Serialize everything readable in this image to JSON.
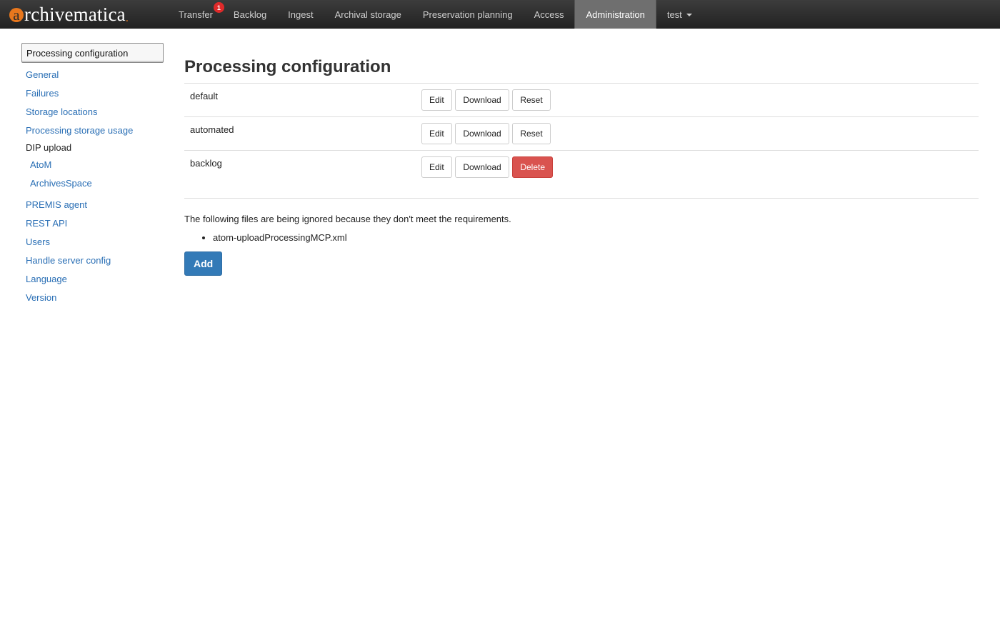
{
  "brand": {
    "name": "rchivematica",
    "initial": "a",
    "mark": "."
  },
  "nav": {
    "transfer": {
      "label": "Transfer",
      "badge": "1"
    },
    "backlog": "Backlog",
    "ingest": "Ingest",
    "archival_storage": "Archival storage",
    "preservation_planning": "Preservation planning",
    "access": "Access",
    "administration": "Administration",
    "user": "test"
  },
  "sidebar": {
    "active": "Processing configuration",
    "items": [
      "General",
      "Failures",
      "Storage locations",
      "Processing storage usage"
    ],
    "dip_upload": {
      "label": "DIP upload",
      "items": [
        "AtoM",
        "ArchivesSpace"
      ]
    },
    "items_after": [
      "PREMIS agent",
      "REST API",
      "Users",
      "Handle server config",
      "Language",
      "Version"
    ]
  },
  "main": {
    "title": "Processing configuration",
    "configs": [
      {
        "name": "default",
        "buttons": [
          "Edit",
          "Download",
          "Reset"
        ]
      },
      {
        "name": "automated",
        "buttons": [
          "Edit",
          "Download",
          "Reset"
        ]
      },
      {
        "name": "backlog",
        "buttons": [
          "Edit",
          "Download",
          "Delete"
        ]
      }
    ],
    "ignored_notice": "The following files are being ignored because they don't meet the requirements.",
    "ignored_files": [
      "atom-uploadProcessingMCP.xml"
    ],
    "add_label": "Add"
  },
  "colors": {
    "navbar_bg": "#222222",
    "nav_active_bg": "#6f6f6f",
    "brand_accent": "#e8771d",
    "link": "#2a6fb5",
    "danger": "#d9534f",
    "primary": "#337ab7",
    "badge": "#e02a2a"
  }
}
